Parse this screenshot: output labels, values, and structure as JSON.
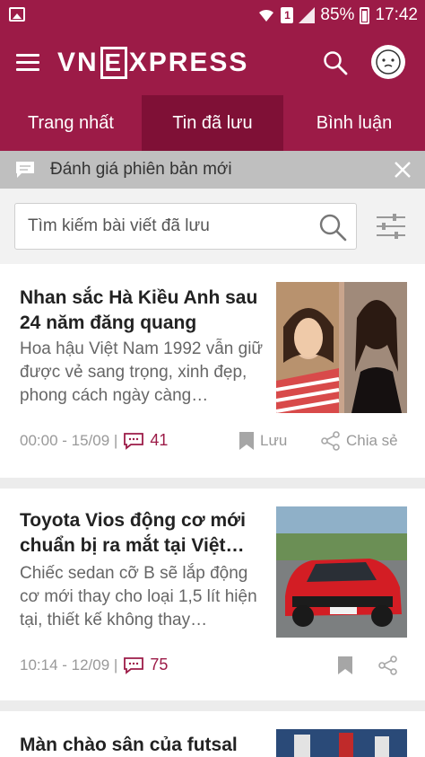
{
  "status_bar": {
    "battery": "85%",
    "time": "17:42",
    "sim": "1"
  },
  "app_bar": {
    "logo_left": "VN",
    "logo_e": "E",
    "logo_right": "XPRESS"
  },
  "tabs": [
    {
      "label": "Trang nhất",
      "active": false
    },
    {
      "label": "Tin đã lưu",
      "active": true
    },
    {
      "label": "Bình luận",
      "active": false
    }
  ],
  "notice": {
    "text": "Đánh giá phiên bản mới"
  },
  "search": {
    "placeholder": "Tìm kiếm bài viết đã lưu"
  },
  "articles": [
    {
      "title": "Nhan sắc Hà Kiều Anh sau 24 năm đăng quang",
      "desc": "Hoa hậu Việt Nam 1992 vẫn giữ được vẻ sang trọng, xinh đẹp, phong cách ngày càng…",
      "time": "00:00 - 15/09 |",
      "comments": "41",
      "save_label": "Lưu",
      "share_label": "Chia sẻ"
    },
    {
      "title": "Toyota Vios động cơ mới chuẩn bị ra mắt tại Việt…",
      "desc": "Chiếc sedan cỡ B sẽ lắp động cơ mới thay cho loại 1,5 lít hiện tại, thiết kế không thay…",
      "time": "10:14 - 12/09 |",
      "comments": "75",
      "save_label": "",
      "share_label": ""
    },
    {
      "title": "Màn chào sân của futsal",
      "desc": "",
      "time": "",
      "comments": "",
      "save_label": "",
      "share_label": ""
    }
  ],
  "colors": {
    "brand": "#9c1b47",
    "brand_dark": "#7f1036",
    "meta": "#999999"
  }
}
